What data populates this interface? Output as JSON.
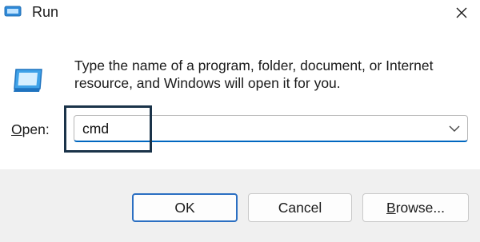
{
  "window": {
    "title": "Run",
    "close_icon": "close-icon",
    "app_icon": "run-icon"
  },
  "content": {
    "description": "Type the name of a program, folder, document, or Internet resource, and Windows will open it for you.",
    "open_label_first": "O",
    "open_label_rest": "pen:",
    "input": {
      "value": "cmd",
      "arrow_icon": "chevron-down-icon"
    }
  },
  "buttons": {
    "ok_label": "OK",
    "cancel_label": "Cancel",
    "browse_label_first": "B",
    "browse_label_rest": "rowse..."
  },
  "colors": {
    "accent": "#0067c0",
    "highlight_box": "#1a3349",
    "footer_bg": "#f0f0f0"
  }
}
